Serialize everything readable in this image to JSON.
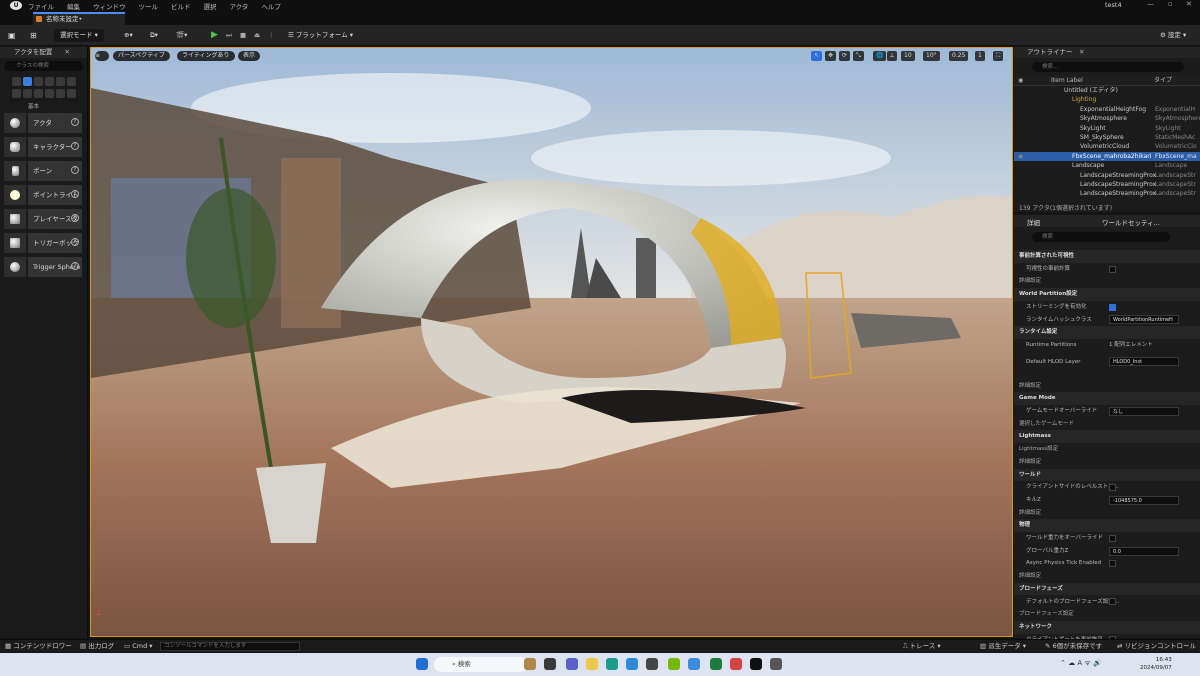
{
  "app": {
    "project_name": "test4",
    "document_tab": "名称未設定•"
  },
  "menu": [
    "ファイル",
    "編集",
    "ウィンドウ",
    "ツール",
    "ビルド",
    "選択",
    "アクタ",
    "ヘルプ"
  ],
  "window_controls": [
    "—",
    "▫",
    "✕"
  ],
  "toolbar": {
    "select_mode": "選択モード",
    "platform": "プラットフォーム",
    "settings": "設定"
  },
  "place_actors": {
    "title": "アクタを配置",
    "search_placeholder": "クラスの検索",
    "category": "基本",
    "items": [
      "アクタ",
      "キャラクター",
      "ポーン",
      "ポイントライト",
      "プレイヤースタート",
      "トリガーボックス",
      "Trigger Sphere"
    ]
  },
  "viewport": {
    "perspective": "パースペクティブ",
    "lighting": "ライティングあり",
    "show": "表示",
    "grid_snap": "10",
    "rot_snap": "10°",
    "scale_snap": "0.25",
    "camera_speed": "1"
  },
  "outliner": {
    "title": "アウトライナー",
    "search_placeholder": "検索...",
    "col_label": "Item Label",
    "col_type": "タイプ",
    "rows": [
      {
        "name": "Untitled (エディタ)",
        "type": "",
        "indent": 0,
        "folder": false,
        "selected": false
      },
      {
        "name": "Lighting",
        "type": "",
        "indent": 1,
        "folder": true,
        "selected": false
      },
      {
        "name": "ExponentialHeightFog",
        "type": "ExponentialH",
        "indent": 2,
        "folder": false,
        "selected": false
      },
      {
        "name": "SkyAtmosphere",
        "type": "SkyAtmosphere",
        "indent": 2,
        "folder": false,
        "selected": false
      },
      {
        "name": "SkyLight",
        "type": "SkyLight",
        "indent": 2,
        "folder": false,
        "selected": false
      },
      {
        "name": "SM_SkySphere",
        "type": "StaticMeshAc",
        "indent": 2,
        "folder": false,
        "selected": false
      },
      {
        "name": "VolumetricCloud",
        "type": "VolumetricClo",
        "indent": 2,
        "folder": false,
        "selected": false
      },
      {
        "name": "FbxScene_mahroba2hikari",
        "type": "FbxScene_ma",
        "indent": 1,
        "folder": false,
        "selected": true
      },
      {
        "name": "Landscape",
        "type": "Landscape",
        "indent": 1,
        "folder": false,
        "selected": false
      },
      {
        "name": "LandscapeStreamingProx",
        "type": "LandscapeStr",
        "indent": 2,
        "folder": false,
        "selected": false
      },
      {
        "name": "LandscapeStreamingProx",
        "type": "LandscapeStr",
        "indent": 2,
        "folder": false,
        "selected": false
      },
      {
        "name": "LandscapeStreamingProx",
        "type": "LandscapeStr",
        "indent": 2,
        "folder": false,
        "selected": false
      }
    ],
    "footer": "139 アクタ(1個選択されています)"
  },
  "details": {
    "tab_details": "詳細",
    "tab_world": "ワールドセッティ...",
    "search_placeholder": "検索",
    "rows": [
      {
        "kind": "sec",
        "label": "事前計算された可視性"
      },
      {
        "kind": "prop",
        "label": "可視性の事前計算",
        "control": "check",
        "checked": false
      },
      {
        "kind": "sub",
        "label": "詳細設定"
      },
      {
        "kind": "sec",
        "label": "World Partition設定"
      },
      {
        "kind": "prop",
        "label": "ストリーミングを有効化",
        "control": "check",
        "checked": true
      },
      {
        "kind": "prop",
        "label": "ランタイムハッシュクラス",
        "control": "value",
        "value": "WorldPartitionRuntimeH"
      },
      {
        "kind": "sec",
        "label": "ランタイム設定"
      },
      {
        "kind": "prop",
        "label": "Runtime Partitions",
        "control": "text",
        "value": "1 配列エレメント"
      },
      {
        "kind": "prop",
        "label": "Default HLOD Layer",
        "control": "value",
        "value": "HLOD0_Inst"
      },
      {
        "kind": "spacer",
        "label": ""
      },
      {
        "kind": "sub",
        "label": "詳細設定"
      },
      {
        "kind": "sec",
        "label": "Game Mode"
      },
      {
        "kind": "prop",
        "label": "ゲームモードオーバーライド",
        "control": "value",
        "value": "なし"
      },
      {
        "kind": "sub",
        "label": "選択したゲームモード"
      },
      {
        "kind": "sec",
        "label": "Lightmass"
      },
      {
        "kind": "sub",
        "label": "Lightmass設定"
      },
      {
        "kind": "sub",
        "label": "詳細設定"
      },
      {
        "kind": "sec",
        "label": "ワールド"
      },
      {
        "kind": "prop",
        "label": "クライアントサイドのレベルストリ...",
        "control": "check",
        "checked": false
      },
      {
        "kind": "prop",
        "label": "キルZ",
        "control": "value",
        "value": "-1048575.0"
      },
      {
        "kind": "sub",
        "label": "詳細設定"
      },
      {
        "kind": "sec",
        "label": "物理"
      },
      {
        "kind": "prop",
        "label": "ワールド重力をオーバーライド",
        "control": "check",
        "checked": false
      },
      {
        "kind": "prop",
        "label": "グローバル重力Z",
        "control": "value",
        "value": "0.0"
      },
      {
        "kind": "prop",
        "label": "Async Physics Tick Enabled",
        "control": "check",
        "checked": false
      },
      {
        "kind": "sub",
        "label": "詳細設定"
      },
      {
        "kind": "sec",
        "label": "ブロードフェーズ"
      },
      {
        "kind": "prop",
        "label": "デフォルトのブロードフェーズ設定...",
        "control": "check",
        "checked": false
      },
      {
        "kind": "sub",
        "label": "ブロードフェーズ設定"
      },
      {
        "kind": "sec",
        "label": "ネットワーク"
      },
      {
        "kind": "prop",
        "label": "クライアントポートを事前許可",
        "control": "check",
        "checked": false
      }
    ]
  },
  "bottombar": {
    "content_drawer": "コンテンツドロワー",
    "output_log": "出力ログ",
    "cmd": "Cmd",
    "cmd_placeholder": "コンソールコマンドを入力します",
    "trace": "トレース",
    "derived_data": "派生データ",
    "unsaved": "6個が未保存です",
    "revision_control": "リビジョンコントロール"
  },
  "taskbar": {
    "search": "検索",
    "time": "16:43",
    "date": "2024/09/07"
  }
}
